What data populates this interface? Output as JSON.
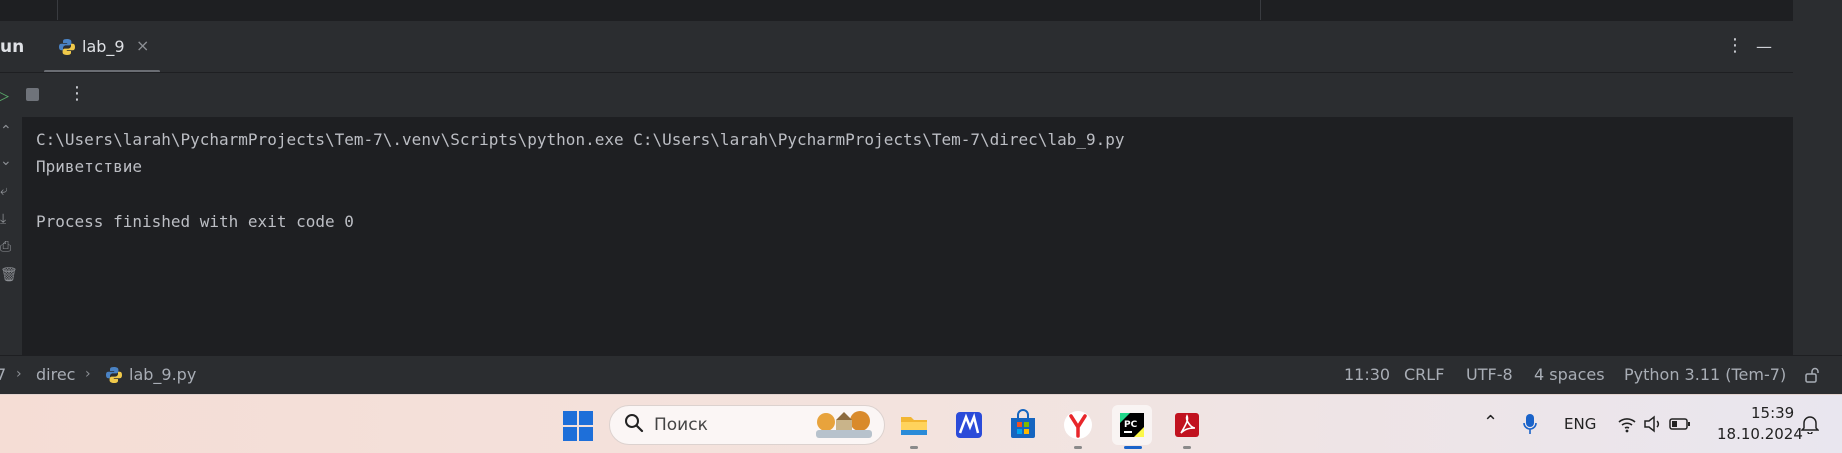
{
  "tool_window": {
    "title": "un",
    "tab": {
      "label": "lab_9",
      "close": "×"
    },
    "header_buttons": {
      "more": "⋮",
      "minimize": "—"
    }
  },
  "toolbar": {
    "more": "⋮"
  },
  "console": {
    "lines": [
      "C:\\Users\\larah\\PycharmProjects\\Tem-7\\.venv\\Scripts\\python.exe C:\\Users\\larah\\PycharmProjects\\Tem-7\\direc\\lab_9.py",
      "Приветствие",
      "",
      "Process finished with exit code 0"
    ]
  },
  "status_bar": {
    "breadcrumb": {
      "root": "7",
      "folder": "direc",
      "file": "lab_9.py"
    },
    "position": "11:30",
    "line_separator": "CRLF",
    "encoding": "UTF-8",
    "indent": "4 spaces",
    "interpreter": "Python 3.11 (Tem-7)"
  },
  "taskbar": {
    "search_placeholder": "Поиск",
    "apps": [
      "file-explorer",
      "meta-app",
      "microsoft-store",
      "yandex-browser",
      "pycharm",
      "pdf-reader"
    ],
    "tray": {
      "language": "ENG",
      "time": "15:39",
      "date": "18.10.2024"
    }
  },
  "colors": {
    "editor_bg": "#1e1f22",
    "panel_bg": "#2b2d30",
    "run_green": "#59a869",
    "windows_blue": "#1e6fd9"
  }
}
